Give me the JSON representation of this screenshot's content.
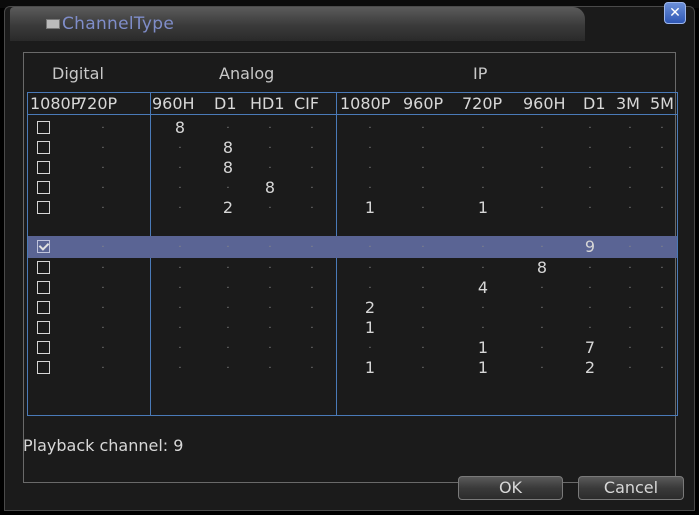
{
  "window": {
    "title": "ChannelType",
    "close_symbol": "✕"
  },
  "groups": {
    "digital": "Digital",
    "analog": "Analog",
    "ip": "IP"
  },
  "columns": [
    {
      "label": "1080P",
      "group": "digital"
    },
    {
      "label": "720P",
      "group": "digital"
    },
    {
      "label": "960H",
      "group": "analog"
    },
    {
      "label": "D1",
      "group": "analog"
    },
    {
      "label": "HD1",
      "group": "analog"
    },
    {
      "label": "CIF",
      "group": "analog"
    },
    {
      "label": "1080P",
      "group": "ip"
    },
    {
      "label": "960P",
      "group": "ip"
    },
    {
      "label": "720P",
      "group": "ip"
    },
    {
      "label": "960H",
      "group": "ip"
    },
    {
      "label": "D1",
      "group": "ip"
    },
    {
      "label": "3M",
      "group": "ip"
    },
    {
      "label": "5M",
      "group": "ip"
    }
  ],
  "rows": [
    {
      "checked": false,
      "values": [
        "",
        "",
        "8",
        "",
        "",
        "",
        "",
        "",
        "",
        "",
        "",
        "",
        ""
      ]
    },
    {
      "checked": false,
      "values": [
        "",
        "",
        "",
        "8",
        "",
        "",
        "",
        "",
        "",
        "",
        "",
        "",
        ""
      ]
    },
    {
      "checked": false,
      "values": [
        "",
        "",
        "",
        "8",
        "",
        "",
        "",
        "",
        "",
        "",
        "",
        "",
        ""
      ]
    },
    {
      "checked": false,
      "values": [
        "",
        "",
        "",
        "",
        "8",
        "",
        "",
        "",
        "",
        "",
        "",
        "",
        ""
      ]
    },
    {
      "checked": false,
      "values": [
        "",
        "",
        "",
        "2",
        "",
        "",
        "1",
        "",
        "1",
        "",
        "",
        "",
        ""
      ]
    },
    {
      "checked": true,
      "values": [
        "",
        "",
        "",
        "",
        "",
        "",
        "",
        "",
        "",
        "",
        "9",
        "",
        ""
      ]
    },
    {
      "checked": false,
      "values": [
        "",
        "",
        "",
        "",
        "",
        "",
        "",
        "",
        "",
        "8",
        "",
        "",
        ""
      ]
    },
    {
      "checked": false,
      "values": [
        "",
        "",
        "",
        "",
        "",
        "",
        "",
        "",
        "4",
        "",
        "",
        "",
        ""
      ]
    },
    {
      "checked": false,
      "values": [
        "",
        "",
        "",
        "",
        "",
        "",
        "2",
        "",
        "",
        "",
        "",
        "",
        ""
      ]
    },
    {
      "checked": false,
      "values": [
        "",
        "",
        "",
        "",
        "",
        "",
        "1",
        "",
        "",
        "",
        "",
        "",
        ""
      ]
    },
    {
      "checked": false,
      "values": [
        "",
        "",
        "",
        "",
        "",
        "",
        "",
        "",
        "1",
        "",
        "7",
        "",
        ""
      ]
    },
    {
      "checked": false,
      "values": [
        "",
        "",
        "",
        "",
        "",
        "",
        "1",
        "",
        "1",
        "",
        "2",
        "",
        ""
      ]
    }
  ],
  "status": {
    "playback_label": "Playback channel: 9"
  },
  "buttons": {
    "ok": "OK",
    "cancel": "Cancel"
  },
  "colors": {
    "title_text": "#7f8dc9",
    "grid_line": "#4a7ab8",
    "selected_row": "#5a6494",
    "close_button": "#3f6bc8"
  }
}
